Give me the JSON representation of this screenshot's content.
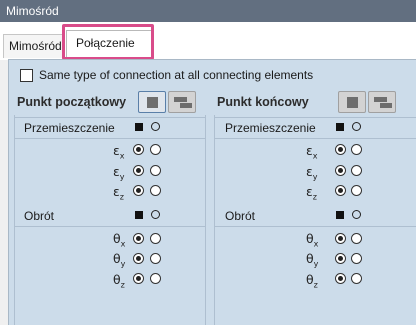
{
  "window": {
    "title": "Mimośród"
  },
  "tabs": [
    {
      "label": "Mimośród",
      "selected": false
    },
    {
      "label": "Połączenie",
      "selected": true
    }
  ],
  "highlight_color": "#d94c8a",
  "options": {
    "same_type_label": "Same type of connection at all connecting elements",
    "same_type_checked": false
  },
  "start": {
    "title": "Punkt początkowy",
    "displacement_label": "Przemieszczenie",
    "rotation_label": "Obrót",
    "displacement": [
      {
        "symbol": "ε",
        "axis": "x",
        "selected": "fixed"
      },
      {
        "symbol": "ε",
        "axis": "y",
        "selected": "fixed"
      },
      {
        "symbol": "ε",
        "axis": "z",
        "selected": "fixed"
      }
    ],
    "rotation": [
      {
        "symbol": "θ",
        "axis": "x",
        "selected": "fixed"
      },
      {
        "symbol": "θ",
        "axis": "y",
        "selected": "fixed"
      },
      {
        "symbol": "θ",
        "axis": "z",
        "selected": "fixed"
      }
    ]
  },
  "end": {
    "title": "Punkt końcowy",
    "displacement_label": "Przemieszczenie",
    "rotation_label": "Obrót",
    "displacement": [
      {
        "symbol": "ε",
        "axis": "x",
        "selected": "fixed"
      },
      {
        "symbol": "ε",
        "axis": "y",
        "selected": "fixed"
      },
      {
        "symbol": "ε",
        "axis": "z",
        "selected": "fixed"
      }
    ],
    "rotation": [
      {
        "symbol": "θ",
        "axis": "x",
        "selected": "fixed"
      },
      {
        "symbol": "θ",
        "axis": "y",
        "selected": "fixed"
      },
      {
        "symbol": "θ",
        "axis": "z",
        "selected": "fixed"
      }
    ]
  },
  "icons": {
    "column_fixed": "filled-square-icon",
    "column_free": "empty-circle-icon",
    "type_a": "square-connection-icon",
    "type_b": "offset-connection-icon"
  }
}
